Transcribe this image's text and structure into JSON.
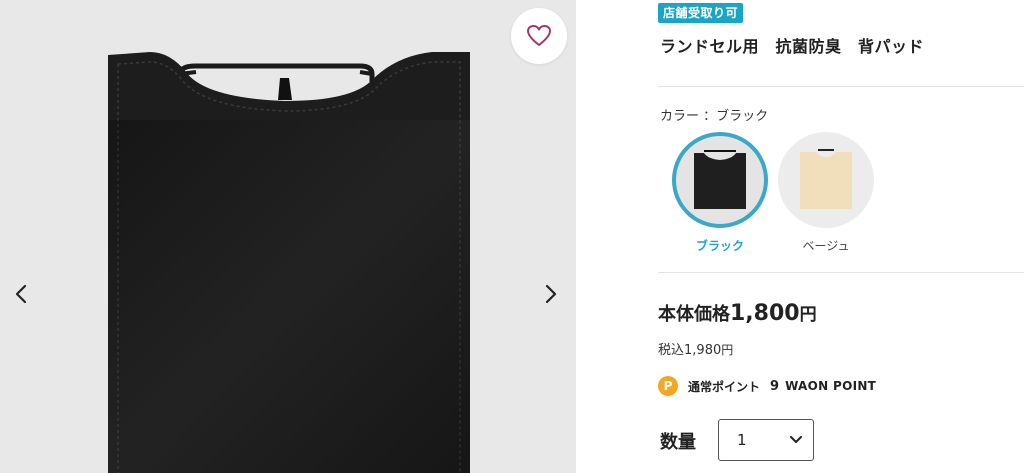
{
  "gallery": {
    "favorite_icon": "heart-outline-icon",
    "prev_icon": "chevron-left-icon",
    "next_icon": "chevron-right-icon"
  },
  "product": {
    "badge": "店舗受取り可",
    "title": "ランドセル用　抗菌防臭　背パッド"
  },
  "color": {
    "label": "カラー ：ブラック",
    "options": [
      {
        "name": "ブラック",
        "selected": true,
        "swatch_color": "#1f1f1f"
      },
      {
        "name": "ベージュ",
        "selected": false,
        "swatch_color": "#f1dfbc"
      }
    ]
  },
  "price": {
    "label": "本体価格",
    "value": "1,800",
    "yen": "円",
    "tax_label": "税込",
    "tax_value": "1,980",
    "tax_yen": "円"
  },
  "points": {
    "icon_letter": "P",
    "label": "通常ポイント",
    "value": "9",
    "unit": "WAON POINT"
  },
  "quantity": {
    "label": "数量",
    "value": "1"
  },
  "colors": {
    "accent": "#1aa5c6",
    "selected_ring": "#3aa8c6",
    "point_badge": "#f5a623",
    "heart": "#a4366f"
  }
}
